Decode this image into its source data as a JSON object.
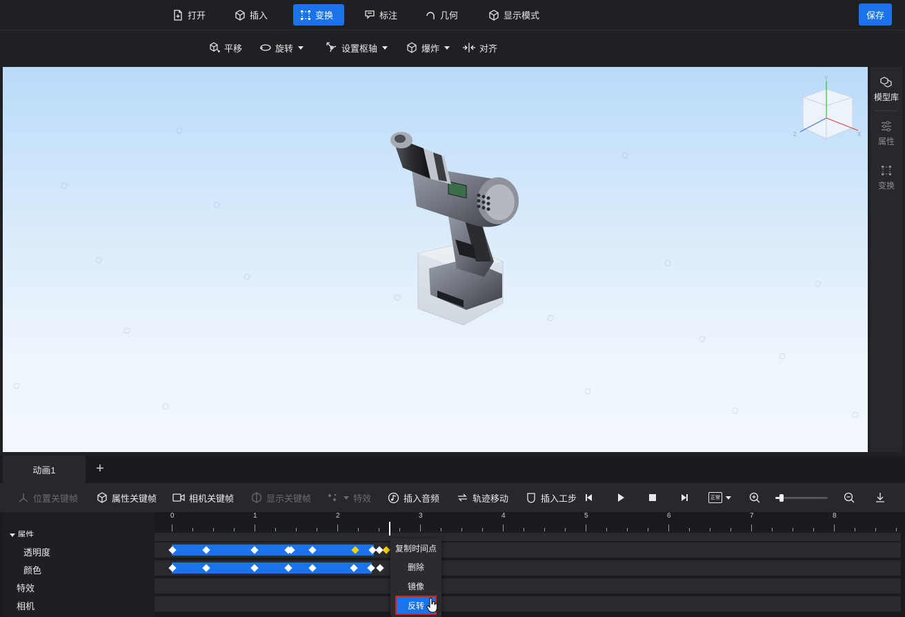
{
  "toolbar": {
    "open": "打开",
    "insert": "插入",
    "transform": "变换",
    "annotate": "标注",
    "geometry": "几何",
    "display_mode": "显示模式",
    "save": "保存"
  },
  "subtoolbar": {
    "translate": "平移",
    "rotate": "旋转",
    "set_pivot": "设置枢轴",
    "explode": "爆炸",
    "align": "对齐"
  },
  "right_panel": {
    "model_library": "模型库",
    "properties": "属性",
    "transform": "变换"
  },
  "axes": {
    "x": "X",
    "y": "Y",
    "z": "Z"
  },
  "anim_tabs": {
    "tab1": "动画1",
    "add": "+"
  },
  "anim_toolbar": {
    "position_keyframe": "位置关键帧",
    "property_keyframe": "属性关键帧",
    "camera_keyframe": "相机关键帧",
    "show_keyframe": "显示关键帧",
    "effects": "特效",
    "insert_audio": "插入音频",
    "track_move": "轨迹移动",
    "insert_step": "插入工步",
    "speed": "正常"
  },
  "timeline": {
    "ruler_labels": [
      "0",
      "1",
      "2",
      "3",
      "4",
      "5",
      "6",
      "7",
      "8"
    ],
    "tracks": {
      "group": "属性",
      "transparency": "透明度",
      "color": "颜色",
      "effects": "特效",
      "camera": "相机"
    }
  },
  "context_menu": {
    "copy_time": "复制时间点",
    "delete": "删除",
    "mirror": "镜像",
    "reverse": "反转"
  },
  "colors": {
    "accent": "#1a73e8",
    "highlight_border": "#d42020",
    "selected_keyframe": "#f5d100"
  }
}
